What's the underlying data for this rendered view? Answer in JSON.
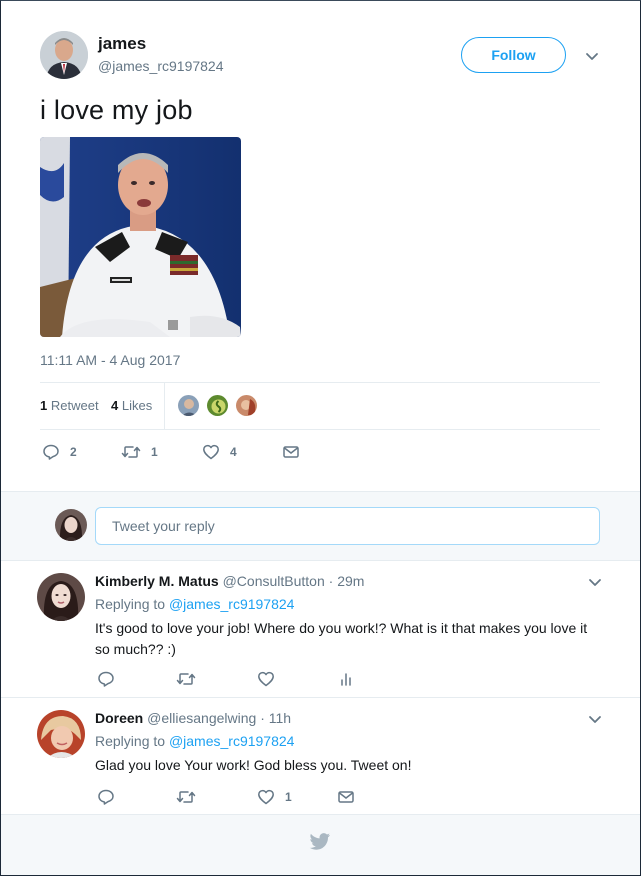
{
  "tweet": {
    "author_name": "james",
    "author_handle": "@james_rc9197824",
    "follow_label": "Follow",
    "text": "i love my job",
    "timestamp": "11:11 AM - 4 Aug 2017",
    "retweets_count": "1",
    "retweets_label": "Retweet",
    "likes_count": "4",
    "likes_label": "Likes",
    "actions": {
      "replies": "2",
      "retweets": "1",
      "likes": "4"
    }
  },
  "reply_box": {
    "placeholder": "Tweet your reply"
  },
  "replies": [
    {
      "name": "Kimberly M. Matus",
      "handle": "@ConsultButton",
      "time": "29m",
      "replying_prefix": "Replying to",
      "replying_to": "@james_rc9197824",
      "text": "It's good to love your job! Where do you work!? What is it that makes you love it so much?? :)"
    },
    {
      "name": "Doreen",
      "handle": "@elliesangelwing",
      "time": "11h",
      "replying_prefix": "Replying to",
      "replying_to": "@james_rc9197824",
      "text": "Glad you love Your work! God bless you. Tweet on!",
      "likes": "1"
    }
  ],
  "colors": {
    "accent": "#1da1f2",
    "muted": "#657786",
    "text": "#14171a",
    "panel": "#f5f8fa"
  }
}
